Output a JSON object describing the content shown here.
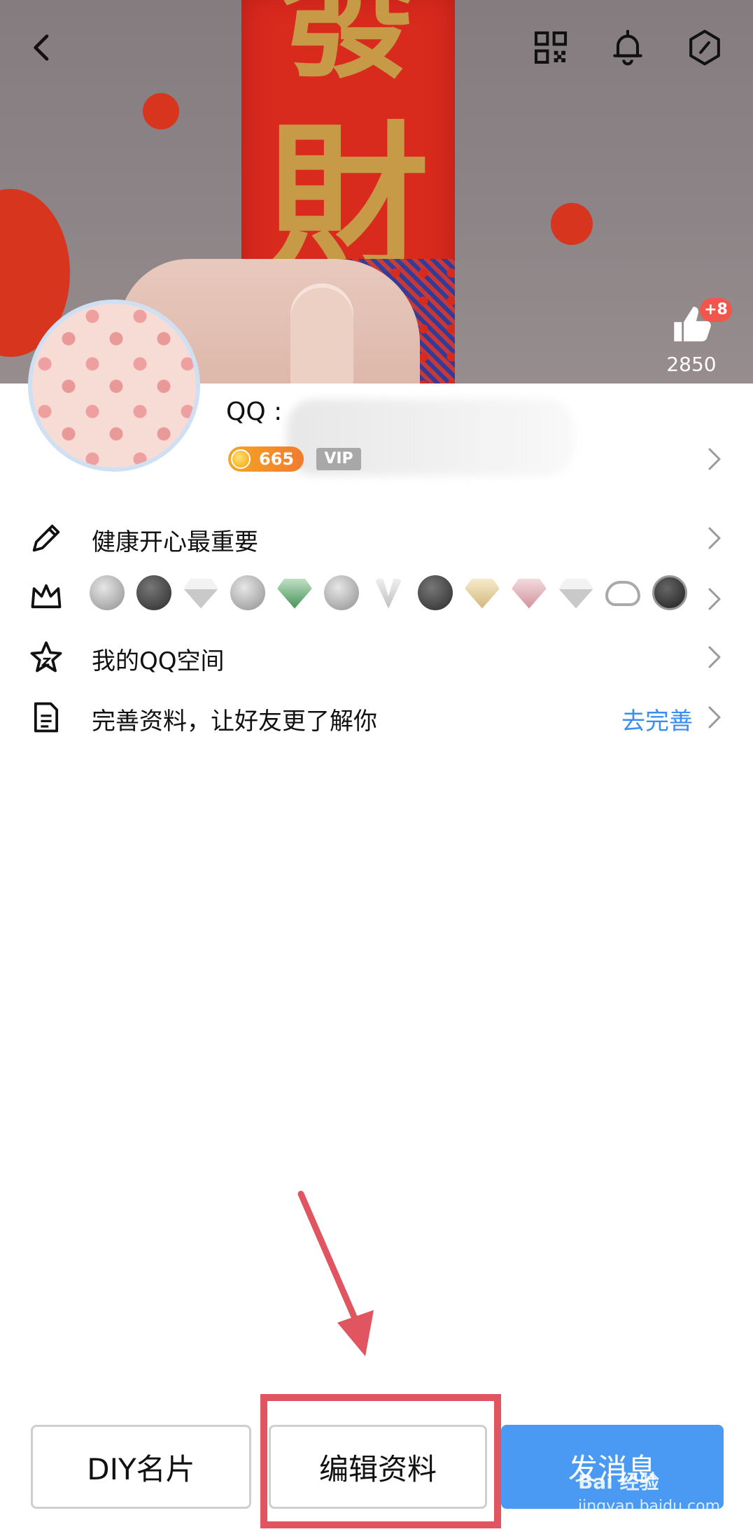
{
  "header": {
    "back_icon": "chevron-left-icon",
    "qrcode_icon": "qrcode-icon",
    "bell_icon": "bell-icon",
    "settings_icon": "hexagon-settings-icon"
  },
  "cover": {
    "couplet_top_char": "發",
    "couplet_char": "財"
  },
  "likes": {
    "badge": "+8",
    "count": "2850"
  },
  "profile": {
    "qq_label": "QQ :",
    "level": "665",
    "vip_label": "VIP"
  },
  "rows": {
    "signature": "健康开心最重要",
    "qzone": "我的QQ空间",
    "complete_profile": "完善资料，让好友更了解你",
    "complete_action": "去完善"
  },
  "buttons": {
    "diy": "DIY名片",
    "edit": "编辑资料",
    "message": "发消息"
  },
  "watermark": {
    "main": "Bai 经验",
    "sub": "jingyan.baidu.com"
  },
  "colors": {
    "accent": "#3b8df2",
    "primary_button": "#4a9af4",
    "annotation_red": "#e05560",
    "badge_red": "#f2554b"
  }
}
